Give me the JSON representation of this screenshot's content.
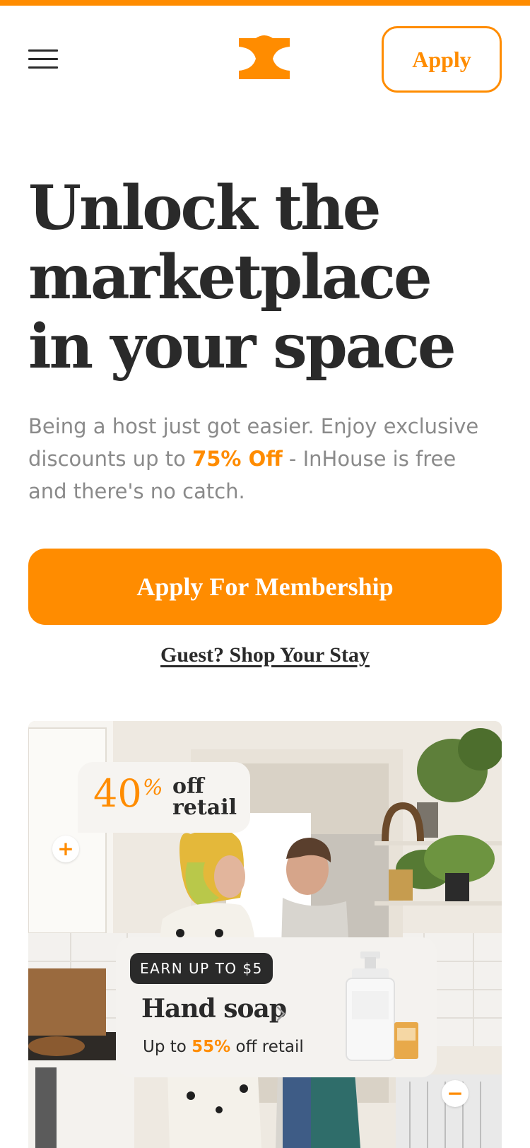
{
  "header": {
    "apply_label": "Apply"
  },
  "hero": {
    "title_line1": "Unlock the",
    "title_line2": "marketplace",
    "title_line3": "in your space",
    "subtitle_part1": "Being a host just got easier. Enjoy exclusive discounts up to ",
    "subtitle_highlight": "75% Off",
    "subtitle_part2": " - InHouse is free and there's no catch.",
    "cta_label": "Apply For Membership",
    "guest_link_label": "Guest? Shop Your Stay"
  },
  "promo": {
    "discount_value": "40",
    "discount_symbol": "%",
    "discount_text_line1": "off",
    "discount_text_line2": "retail",
    "plus_hotspot": "+",
    "minus_hotspot": "−",
    "product": {
      "badge": "EARN UP TO $5",
      "name": "Hand soap",
      "off_prefix": "Up to ",
      "off_value": "55%",
      "off_suffix": " off retail"
    }
  },
  "colors": {
    "brand_orange": "#ff8c00",
    "text_dark": "#2a2a2a",
    "text_muted": "#8a8a8a"
  },
  "icons": [
    "menu-icon",
    "inhouse-logo",
    "chevron-right-icon",
    "plus-icon",
    "minus-icon"
  ]
}
